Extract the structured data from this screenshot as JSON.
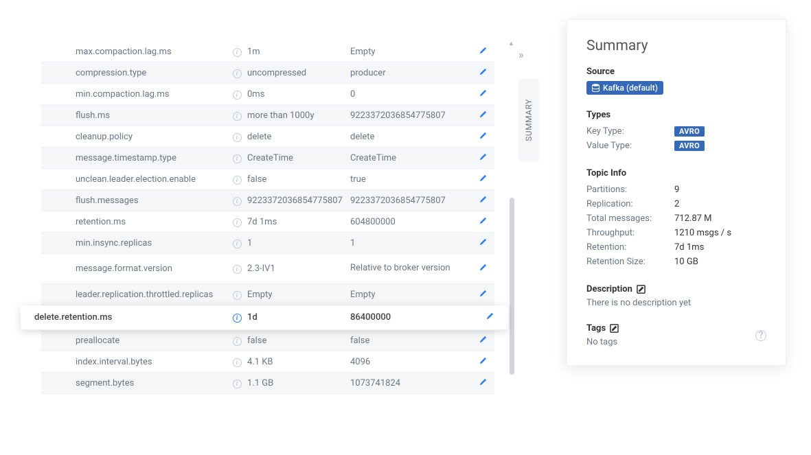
{
  "config_rows": [
    {
      "name": "max.compaction.lag.ms",
      "val1": "1m",
      "val2": "Empty",
      "alt": false
    },
    {
      "name": "compression.type",
      "val1": "uncompressed",
      "val2": "producer",
      "alt": true
    },
    {
      "name": "min.compaction.lag.ms",
      "val1": "0ms",
      "val2": "0",
      "alt": false
    },
    {
      "name": "flush.ms",
      "val1": "more than 1000y",
      "val2": "9223372036854775807",
      "alt": true
    },
    {
      "name": "cleanup.policy",
      "val1": "delete",
      "val2": "delete",
      "alt": false
    },
    {
      "name": "message.timestamp.type",
      "val1": "CreateTime",
      "val2": "CreateTime",
      "alt": true
    },
    {
      "name": "unclean.leader.election.enable",
      "val1": "false",
      "val2": "true",
      "alt": false
    },
    {
      "name": "flush.messages",
      "val1": "9223372036854775807",
      "val2": "9223372036854775807",
      "alt": true
    },
    {
      "name": "retention.ms",
      "val1": "7d 1ms",
      "val2": "604800000",
      "alt": false
    },
    {
      "name": "min.insync.replicas",
      "val1": "1",
      "val2": "1",
      "alt": true
    },
    {
      "name": "message.format.version",
      "val1": "2.3-IV1",
      "val2": "Relative to broker version",
      "alt": false,
      "tall": true
    },
    {
      "name": "leader.replication.throttled.replicas",
      "val1": "Empty",
      "val2": "Empty",
      "alt": true
    },
    {
      "name": "delete.retention.ms",
      "val1": "1d",
      "val2": "86400000",
      "alt": false,
      "highlighted": true
    },
    {
      "name": "preallocate",
      "val1": "false",
      "val2": "false",
      "alt": true
    },
    {
      "name": "index.interval.bytes",
      "val1": "4.1 KB",
      "val2": "4096",
      "alt": false
    },
    {
      "name": "segment.bytes",
      "val1": "1.1 GB",
      "val2": "1073741824",
      "alt": true
    }
  ],
  "sidebar_tab": "SUMMARY",
  "summary": {
    "title": "Summary",
    "source_label": "Source",
    "source_badge": "Kafka (default)",
    "types_label": "Types",
    "key_type_label": "Key Type:",
    "key_type_value": "AVRO",
    "value_type_label": "Value Type:",
    "value_type_value": "AVRO",
    "topic_info_label": "Topic Info",
    "info": [
      {
        "k": "Partitions:",
        "v": "9"
      },
      {
        "k": "Replication:",
        "v": "2"
      },
      {
        "k": "Total messages:",
        "v": "712.87 M"
      },
      {
        "k": "Throughput:",
        "v": "1210 msgs / s"
      },
      {
        "k": "Retention:",
        "v": "7d 1ms"
      },
      {
        "k": "Retention Size:",
        "v": "10 GB"
      }
    ],
    "description_label": "Description",
    "description_text": "There is no description yet",
    "tags_label": "Tags",
    "tags_text": "No tags"
  }
}
